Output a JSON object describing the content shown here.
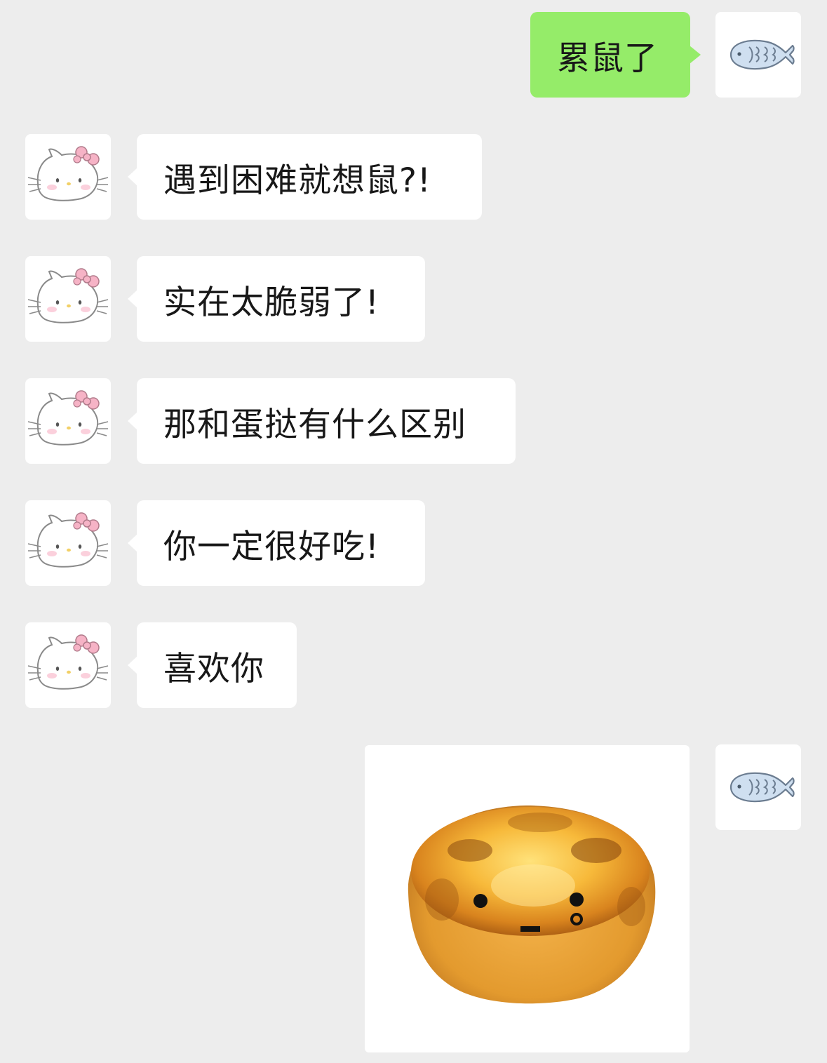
{
  "colors": {
    "background": "#ededed",
    "incoming_bubble": "#ffffff",
    "outgoing_bubble": "#95ec69",
    "text": "#181818"
  },
  "icons": {
    "self_avatar": "fish-taiyaki-icon",
    "friend_avatar": "hello-kitty-icon"
  },
  "messages": [
    {
      "sender": "self",
      "type": "text",
      "text": "累鼠了"
    },
    {
      "sender": "friend",
      "type": "text",
      "text": "遇到困难就想鼠?!"
    },
    {
      "sender": "friend",
      "type": "text",
      "text": "实在太脆弱了!"
    },
    {
      "sender": "friend",
      "type": "text",
      "text": "那和蛋挞有什么区别"
    },
    {
      "sender": "friend",
      "type": "text",
      "text": "你一定很好吃!"
    },
    {
      "sender": "friend",
      "type": "text",
      "text": "喜欢你"
    },
    {
      "sender": "self",
      "type": "image",
      "image": "egg-tart-with-face"
    }
  ]
}
